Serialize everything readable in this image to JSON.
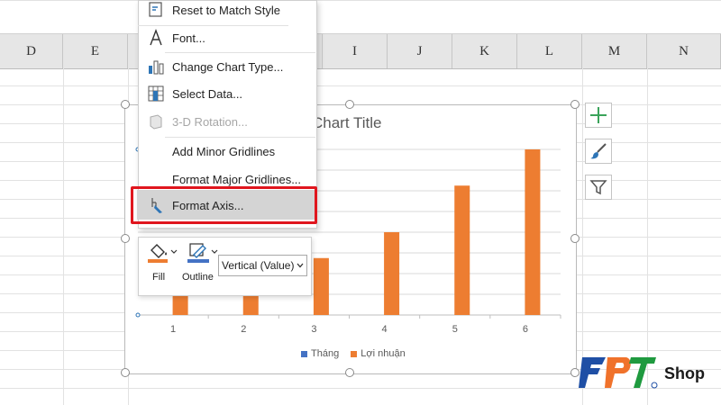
{
  "columns": [
    "D",
    "E",
    "",
    "",
    "",
    "I",
    "J",
    "K",
    "L",
    "M",
    "N"
  ],
  "chart": {
    "title": "Chart Title",
    "chart_data": {
      "type": "bar",
      "title": "Chart Title",
      "categories": [
        "1",
        "2",
        "3",
        "4",
        "5",
        "6"
      ],
      "series": [
        {
          "name": "Tháng",
          "values": [
            0,
            0,
            0,
            0,
            0,
            0
          ],
          "color": "#4472c4"
        },
        {
          "name": "Lợi nhuận",
          "values": [
            2,
            3,
            5.5,
            8,
            12.5,
            16
          ],
          "color": "#ed7d31"
        }
      ],
      "ylim": [
        0,
        16
      ],
      "grid": true,
      "legend": "bottom"
    },
    "legend": [
      "Tháng",
      "Lợi nhuận"
    ],
    "side_buttons": [
      "chart-elements-icon",
      "chart-styles-icon",
      "chart-filters-icon"
    ]
  },
  "context_menu": {
    "items": [
      {
        "label": "Reset to Match Style",
        "icon": "reset-style-icon",
        "disabled": false
      },
      {
        "label": "Font...",
        "icon": "font-icon",
        "disabled": false
      },
      {
        "label": "Change Chart Type...",
        "icon": "chart-type-icon",
        "disabled": false
      },
      {
        "label": "Select Data...",
        "icon": "select-data-icon",
        "disabled": false
      },
      {
        "label": "3-D Rotation...",
        "icon": "rotation-icon",
        "disabled": true
      },
      {
        "label": "Add Minor Gridlines",
        "icon": "",
        "disabled": false
      },
      {
        "label": "Format Major Gridlines...",
        "icon": "",
        "disabled": false
      },
      {
        "label": "Format Axis...",
        "icon": "format-axis-icon",
        "disabled": false
      }
    ]
  },
  "mini_toolbar": {
    "fill_label": "Fill",
    "outline_label": "Outline",
    "element_select": "Vertical (Value)"
  },
  "watermark": {
    "brand": "FPT",
    "suffix": "Shop"
  },
  "colors": {
    "accent_orange": "#ed7d31",
    "accent_blue": "#4472c4",
    "highlight_red": "#e0161e"
  }
}
